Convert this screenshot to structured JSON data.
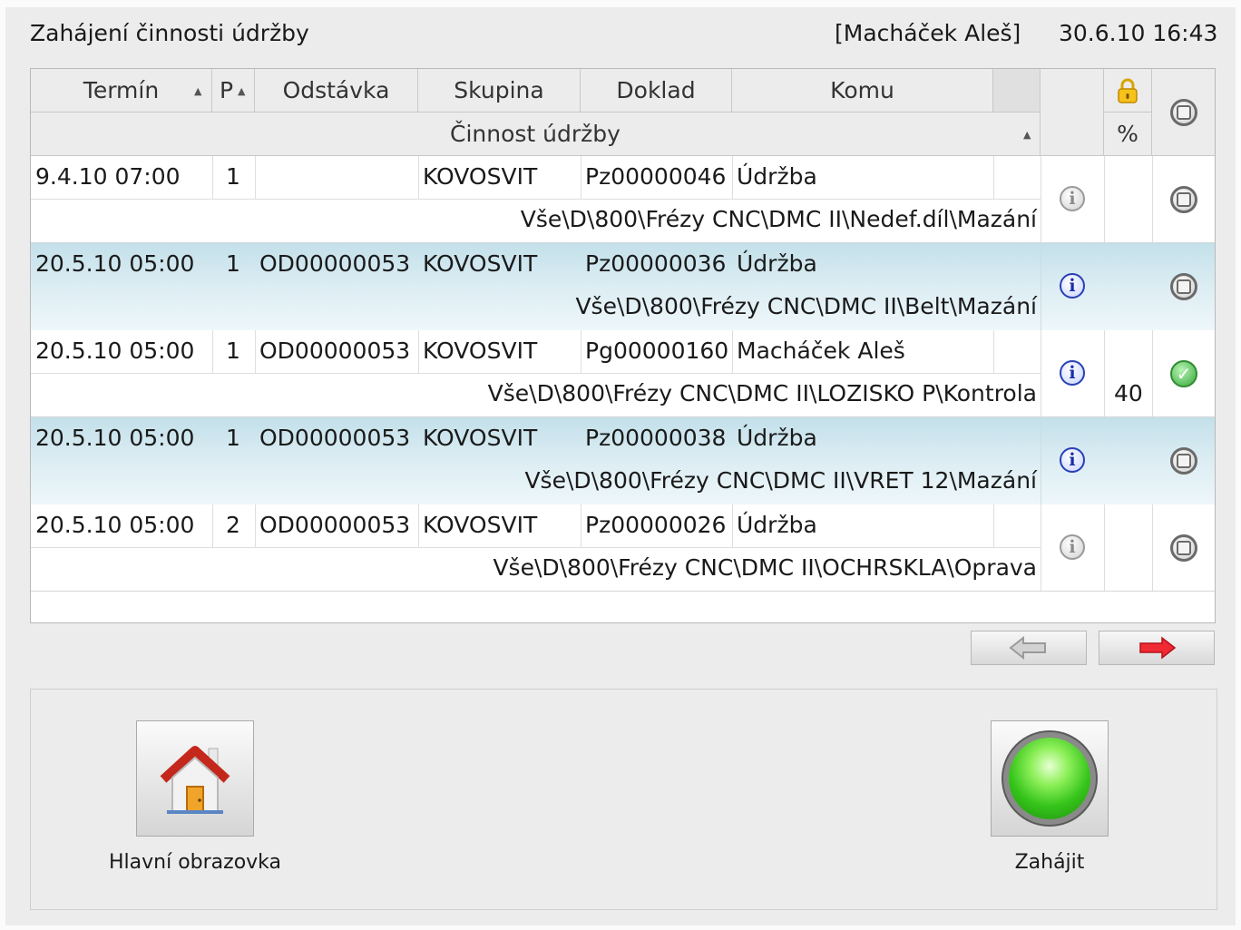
{
  "header": {
    "title": "Zahájení činnosti údržby",
    "user": "[Macháček Aleš]",
    "datetime": "30.6.10 16:43"
  },
  "grid": {
    "columns": {
      "termin": "Termín",
      "p": "P",
      "odstavka": "Odstávka",
      "skupina": "Skupina",
      "doklad": "Doklad",
      "komu": "Komu",
      "cinnost": "Činnost údržby",
      "percent": "%"
    },
    "sort_arrow": "▲",
    "rows": [
      {
        "termin": "9.4.10 07:00",
        "p": "1",
        "odstavka": "",
        "skupina": "KOVOSVIT",
        "doklad": "Pz00000046",
        "komu": "Údržba",
        "path": "Vše\\D\\800\\Frézy CNC\\DMC II\\Nedef.díl\\Mazání",
        "percent": "",
        "info": "info-grey-icon",
        "status": "stopped"
      },
      {
        "termin": "20.5.10 05:00",
        "p": "1",
        "odstavka": "OD00000053",
        "skupina": "KOVOSVIT",
        "doklad": "Pz00000036",
        "komu": "Údržba",
        "path": "Vše\\D\\800\\Frézy CNC\\DMC II\\Belt\\Mazání",
        "percent": "",
        "info": "info-blue-icon",
        "status": "stopped"
      },
      {
        "termin": "20.5.10 05:00",
        "p": "1",
        "odstavka": "OD00000053",
        "skupina": "KOVOSVIT",
        "doklad": "Pg00000160",
        "komu": "Macháček Aleš",
        "path": "Vše\\D\\800\\Frézy CNC\\DMC II\\LOZISKO P\\Kontrola",
        "percent": "40",
        "info": "info-blue-icon",
        "status": "done"
      },
      {
        "termin": "20.5.10 05:00",
        "p": "1",
        "odstavka": "OD00000053",
        "skupina": "KOVOSVIT",
        "doklad": "Pz00000038",
        "komu": "Údržba",
        "path": "Vše\\D\\800\\Frézy CNC\\DMC II\\VRET 12\\Mazání",
        "percent": "",
        "info": "info-blue-icon",
        "status": "stopped"
      },
      {
        "termin": "20.5.10 05:00",
        "p": "2",
        "odstavka": "OD00000053",
        "skupina": "KOVOSVIT",
        "doklad": "Pz00000026",
        "komu": "Údržba",
        "path": "Vše\\D\\800\\Frézy CNC\\DMC II\\OCHRSKLA\\Oprava",
        "percent": "",
        "info": "info-grey-icon",
        "status": "stopped"
      }
    ]
  },
  "nav": {
    "prev_icon": "arrow-left-icon",
    "next_icon": "arrow-right-icon"
  },
  "actions": {
    "home_label": "Hlavní obrazovka",
    "home_icon": "house-icon",
    "start_label": "Zahájit",
    "start_icon": "green-light-icon"
  },
  "colors": {
    "selected_row": "#cbe5ee",
    "next_arrow": "#e8212b",
    "prev_arrow": "#b3b3b3",
    "ok": "#36a836"
  }
}
